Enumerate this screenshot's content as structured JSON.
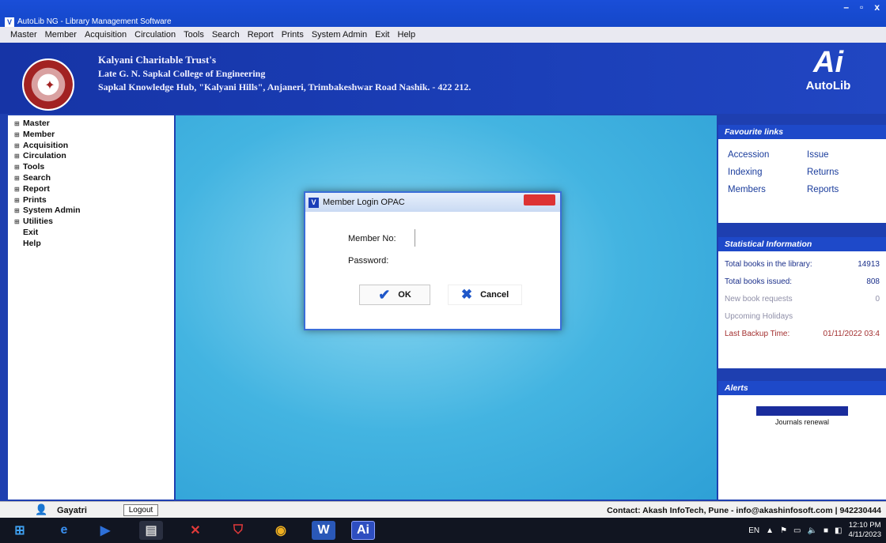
{
  "window": {
    "title": "AutoLib NG - Library Management Software",
    "controls": [
      "–",
      "▫",
      "x"
    ]
  },
  "menubar": [
    "Master",
    "Member",
    "Acquisition",
    "Circulation",
    "Tools",
    "Search",
    "Report",
    "Prints",
    "System Admin",
    "Exit",
    "Help"
  ],
  "banner": {
    "line1": "Kalyani Charitable Trust's",
    "line2": "Late G. N. Sapkal College of Engineering",
    "line3": "Sapkal Knowledge Hub, \"Kalyani Hills\", Anjaneri, Trimbakeshwar Road Nashik. - 422 212.",
    "brand_mark": "Ai",
    "brand_name": "AutoLib"
  },
  "leftnav": [
    {
      "label": "Master",
      "expandable": true
    },
    {
      "label": "Member",
      "expandable": true
    },
    {
      "label": "Acquisition",
      "expandable": true
    },
    {
      "label": "Circulation",
      "expandable": true
    },
    {
      "label": "Tools",
      "expandable": true
    },
    {
      "label": "Search",
      "expandable": true
    },
    {
      "label": "Report",
      "expandable": true
    },
    {
      "label": "Prints",
      "expandable": true
    },
    {
      "label": "System Admin",
      "expandable": true
    },
    {
      "label": "Utilities",
      "expandable": true
    },
    {
      "label": "Exit",
      "expandable": false
    },
    {
      "label": "Help",
      "expandable": false
    }
  ],
  "dialog": {
    "title": "Member Login OPAC",
    "close_label": "",
    "member_label": "Member No:",
    "member_value": "",
    "password_label": "Password:",
    "password_value": "",
    "ok_label": "OK",
    "cancel_label": "Cancel"
  },
  "favourite": {
    "heading": "Favourite links",
    "links": [
      "Accession",
      "Issue",
      "Indexing",
      "Returns",
      "Members",
      "Reports"
    ]
  },
  "stats": {
    "heading": "Statistical Information",
    "rows": [
      {
        "label": "Total books in the library:",
        "value": "14913"
      },
      {
        "label": "Total books issued:",
        "value": "808"
      },
      {
        "label": "New book requests",
        "value": "0"
      },
      {
        "label": "Upcoming Holidays",
        "value": ""
      },
      {
        "label": "Last Backup Time:",
        "value": "01/11/2022 03:4"
      }
    ]
  },
  "alerts": {
    "heading": "Alerts",
    "text": "Journals renewal"
  },
  "statusbar": {
    "user": "Gayatri",
    "logout": "Logout",
    "contact": "Contact: Akash InfoTech, Pune - info@akashinfosoft.com | 942230444"
  },
  "taskbar": {
    "lang": "EN",
    "time": "12:10 PM",
    "date": "4/11/2023"
  },
  "colors": {
    "banner": "#1b3fb8",
    "desktop": "#43b4e1",
    "panel_head": "#1e49c9"
  }
}
